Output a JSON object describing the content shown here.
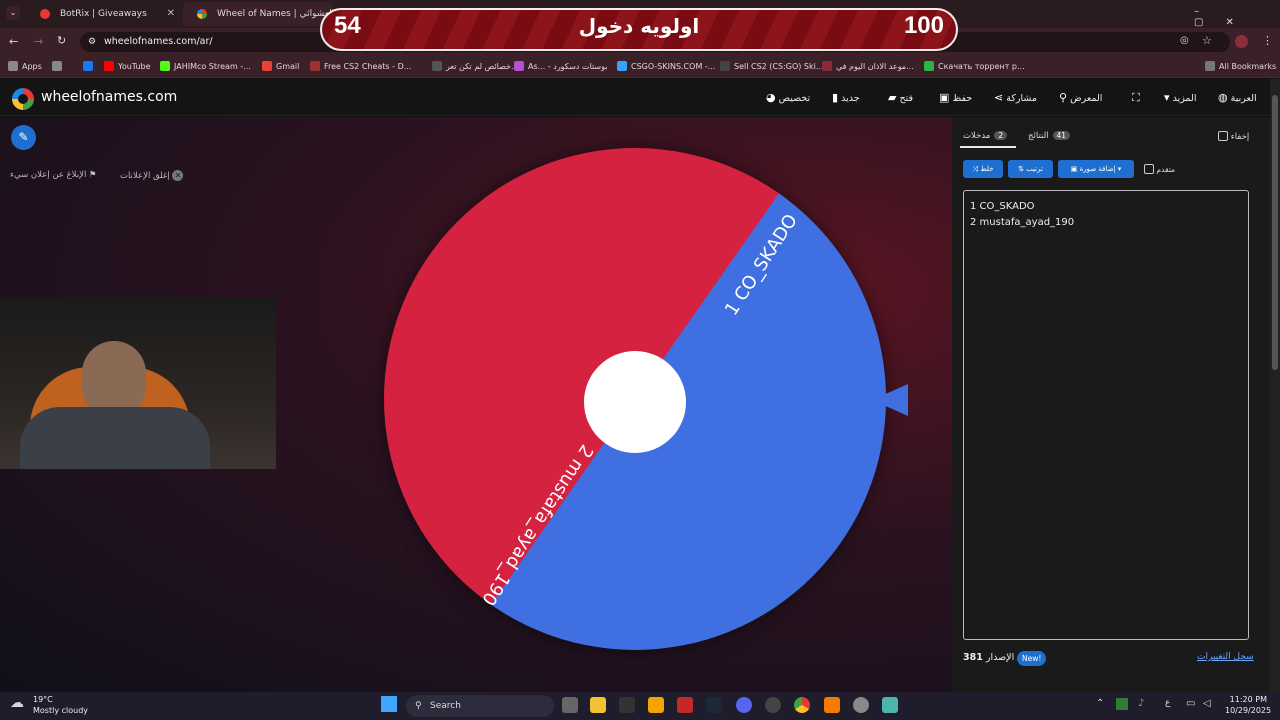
{
  "browser": {
    "tabs": [
      {
        "label": "BotRix | Giveaways",
        "color": "#e53935"
      },
      {
        "label": "Wheel of Names | العشوائي",
        "color": "#1e88e5"
      }
    ],
    "url": "wheelofnames.com/ar/",
    "bookmarks": [
      {
        "label": "Apps",
        "color": "#888888"
      },
      {
        "label": "",
        "color": "#888888"
      },
      {
        "label": "",
        "color": "#1877f2"
      },
      {
        "label": "YouTube",
        "color": "#ff0000"
      },
      {
        "label": "JAHIMco Stream -...",
        "color": "#53fc18"
      },
      {
        "label": "Gmail",
        "color": "#ea4335"
      },
      {
        "label": "Free CS2 Cheats - D...",
        "color": "#a03030"
      },
      {
        "label": "خصائص لم تكن تعر...",
        "color": "#555555"
      },
      {
        "label": "As... - بوستات دسكورد",
        "color": "#b44fd6"
      },
      {
        "label": "CSGO-SKINS.COM -...",
        "color": "#3aa0ff"
      },
      {
        "label": "Sell CS2 (CS:GO) Ski...",
        "color": "#444444"
      },
      {
        "label": "موعد الاذان اليوم في...",
        "color": "#8b2a3a"
      },
      {
        "label": "Скачать торрент р...",
        "color": "#2fb344"
      }
    ],
    "all_bookmarks": "All Bookmarks"
  },
  "overlay": {
    "left_number": "54",
    "title": "اولويه دخول",
    "right_number": "100"
  },
  "app": {
    "brand": "wheelofnames.com",
    "nav": {
      "customize": "تخصيص",
      "new": "جديد",
      "open": "فتح",
      "save": "حفظ",
      "share": "مشاركة",
      "gallery": "المعرض",
      "more": "المزيد",
      "language": "العربية"
    },
    "ads": {
      "close_ads": "إغلق الإعلانات",
      "report_ad": "الإبلاغ عن إعلان سيء"
    }
  },
  "panel": {
    "hide": "إخفاء",
    "tab_results": "النتائج",
    "results_count": "41",
    "tab_entries": "مدخلات",
    "entries_count": "2",
    "shuffle": "خلط",
    "sort": "ترتيب",
    "add_image": "إضافة صورة",
    "advanced": "متقدم",
    "entries": [
      "1 CO_SKADO",
      "2 mustafa_ayad_190"
    ],
    "version_label": "الإصدار",
    "version": "381",
    "new_badge": "New!",
    "changelog": "سجل التغييرات"
  },
  "chart_data": {
    "type": "pie",
    "categories": [
      "1 CO_SKADO",
      "2 mustafa_ayad_190"
    ],
    "values": [
      1,
      1
    ],
    "colors": [
      "#3f6fe0",
      "#d42240"
    ]
  },
  "taskbar": {
    "weather_temp": "19°C",
    "weather_desc": "Mostly cloudy",
    "search": "Search",
    "lang": "ع",
    "time": "11:20 PM",
    "date": "10/29/2025"
  }
}
